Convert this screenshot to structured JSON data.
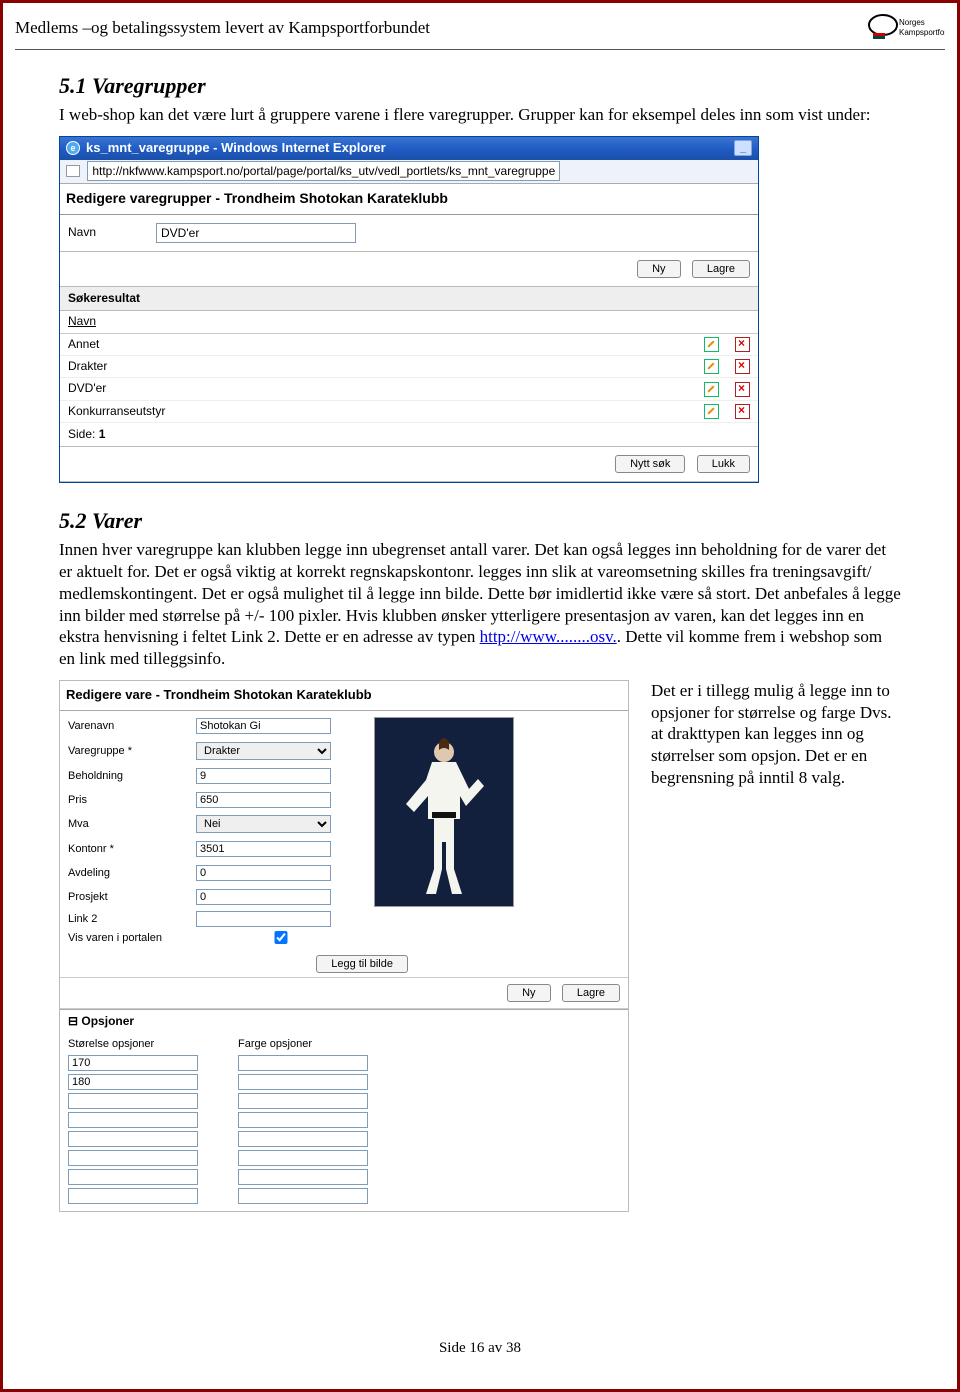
{
  "header": {
    "left": "Medlems –og betalingssystem levert av Kampsportforbundet",
    "logo_text": "Norges\nKampsportforbund"
  },
  "section1": {
    "heading": "5.1  Varegrupper",
    "text": "I web-shop kan det være lurt å gruppere varene i flere varegrupper. Grupper kan for eksempel deles inn som vist under:"
  },
  "ie": {
    "title": "ks_mnt_varegruppe - Windows Internet Explorer",
    "url": "http://nkfwww.kampsport.no/portal/page/portal/ks_utv/vedl_portlets/ks_mnt_varegruppe",
    "app_heading": "Redigere varegrupper - Trondheim Shotokan Karateklubb",
    "navn_label": "Navn",
    "navn_value": "DVD'er",
    "buttons": {
      "ny": "Ny",
      "lagre": "Lagre",
      "nytt_sok": "Nytt søk",
      "lukk": "Lukk"
    },
    "soke_h": "Søkeresultat",
    "col_navn": "Navn",
    "rows": [
      "Annet",
      "Drakter",
      "DVD'er",
      "Konkurranseutstyr"
    ],
    "side_label": "Side:",
    "side_val": "1"
  },
  "section2": {
    "heading": "5.2  Varer",
    "text1": "Innen hver varegruppe kan klubben legge inn ubegrenset antall varer. Det kan også legges inn beholdning for de varer det er aktuelt for. Det er også viktig at korrekt regnskapskontonr. legges inn slik at vareomsetning skilles fra treningsavgift/ medlemskontingent. Det er også mulighet til å legge inn bilde. Dette bør imidlertid ikke være så stort. Det anbefales å legge inn bilder med størrelse på +/- 100 pixler. Hvis klubben ønsker ytterligere presentasjon av varen, kan det legges inn en ekstra henvisning i feltet Link 2. Dette er en adresse av typen ",
    "link_text": "http://www........osv.",
    "text2": ". Dette vil komme frem i webshop som en link med tilleggsinfo."
  },
  "edit": {
    "heading": "Redigere vare - Trondheim Shotokan Karateklubb",
    "labels": {
      "varenavn": "Varenavn",
      "varegruppe": "Varegruppe *",
      "beholdning": "Beholdning",
      "pris": "Pris",
      "mva": "Mva",
      "kontonr": "Kontonr *",
      "avdeling": "Avdeling",
      "prosjekt": "Prosjekt",
      "link2": "Link 2",
      "vis": "Vis varen i portalen"
    },
    "values": {
      "varenavn": "Shotokan Gi",
      "varegruppe": "Drakter",
      "beholdning": "9",
      "pris": "650",
      "mva": "Nei",
      "kontonr": "3501",
      "avdeling": "0",
      "prosjekt": "0",
      "link2": "",
      "vis": true
    },
    "btn_addimg": "Legg til bilde",
    "btn_ny": "Ny",
    "btn_lagre": "Lagre",
    "ops_heading": "Opsjoner",
    "ops_storrelse": "Størelse opsjoner",
    "ops_farge": "Farge opsjoner",
    "ops_vals": [
      "170",
      "180",
      "",
      "",
      "",
      "",
      "",
      ""
    ]
  },
  "sidetext": "Det er i tillegg mulig å legge inn to opsjoner for størrelse og farge Dvs. at drakttypen kan legges inn og størrelser som opsjon. Det er en begrensning på inntil 8 valg.",
  "footer": "Side 16 av 38"
}
